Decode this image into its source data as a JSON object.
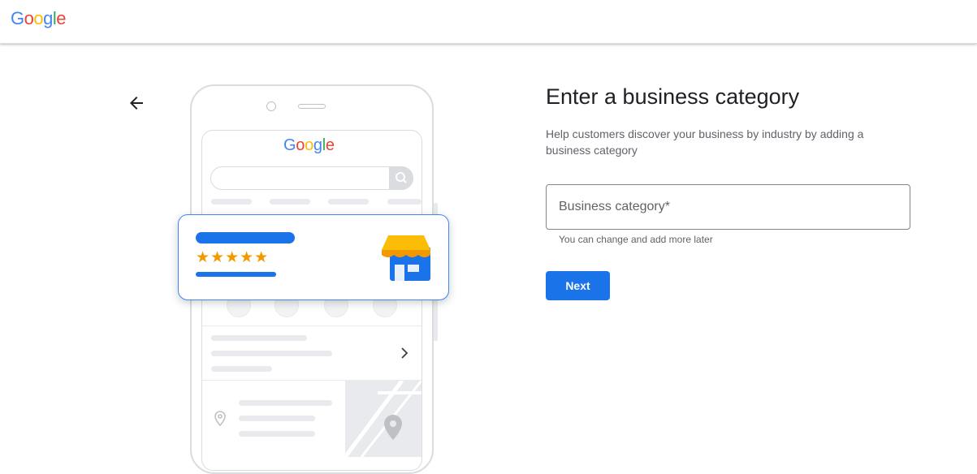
{
  "header": {
    "logo_letters": [
      "G",
      "o",
      "o",
      "g",
      "l",
      "e"
    ]
  },
  "illustration": {
    "mini_logo_letters": [
      "G",
      "o",
      "o",
      "g",
      "l",
      "e"
    ],
    "rating_stars": "★★★★★",
    "rating": 5,
    "icons": [
      "search-icon",
      "phone-icon",
      "directions-icon",
      "bookmark-icon",
      "globe-icon",
      "chevron-right-icon",
      "location-pin-icon",
      "storefront-icon"
    ]
  },
  "main": {
    "title": "Enter a business category",
    "subtitle": "Help customers discover your business by industry by adding a business category",
    "category_field": {
      "placeholder": "Business category*",
      "value": ""
    },
    "helper_text": "You can change and add more later",
    "next_label": "Next"
  },
  "colors": {
    "primary": "#1a73e8",
    "star": "#f29900",
    "google_blue": "#4285f4",
    "google_red": "#ea4335",
    "google_yellow": "#fbbc05",
    "google_green": "#34a853"
  }
}
